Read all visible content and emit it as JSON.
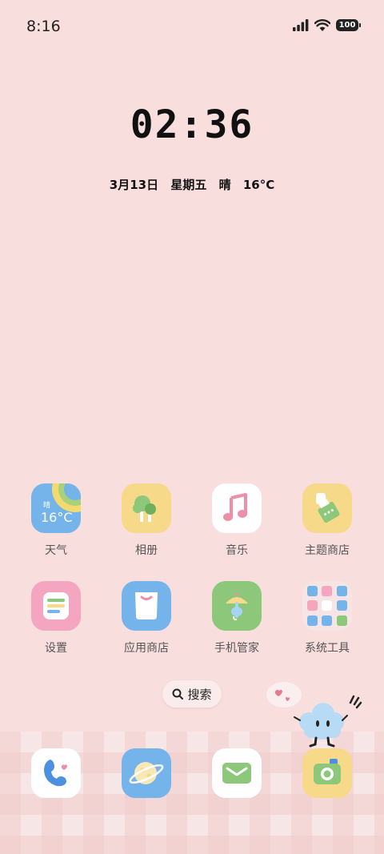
{
  "status": {
    "time": "8:16",
    "battery": "100"
  },
  "clock": {
    "time": "02:36"
  },
  "date": {
    "date": "3月13日",
    "weekday": "星期五",
    "weather": "晴",
    "temp": "16°C"
  },
  "apps": [
    {
      "name": "天气",
      "icon": "weather-icon",
      "widget_condition": "晴",
      "widget_temp": "16°C"
    },
    {
      "name": "相册",
      "icon": "gallery-icon"
    },
    {
      "name": "音乐",
      "icon": "music-icon"
    },
    {
      "name": "主题商店",
      "icon": "themes-icon"
    },
    {
      "name": "设置",
      "icon": "settings-icon"
    },
    {
      "name": "应用商店",
      "icon": "app-store-icon"
    },
    {
      "name": "手机管家",
      "icon": "security-icon"
    },
    {
      "name": "系统工具",
      "icon": "folder-icon"
    }
  ],
  "search": {
    "label": "搜索"
  },
  "dock": [
    "phone-icon",
    "browser-icon",
    "messages-icon",
    "camera-icon"
  ],
  "colors": {
    "background": "#f9dede",
    "blue": "#7ab9ec",
    "yellow": "#f7d98a",
    "green": "#8cc77a",
    "pink": "#f4a6c0"
  }
}
